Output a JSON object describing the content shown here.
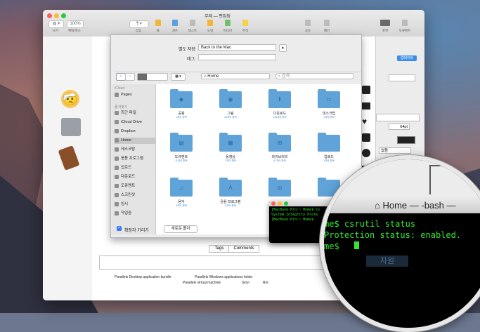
{
  "pages": {
    "title": "무제 — 편집됨",
    "toolbar": {
      "left_btn1": "보기",
      "left_btn2": "확대/축소",
      "zoom_value": "100%",
      "items": [
        {
          "label": "삽입"
        },
        {
          "label": "표"
        },
        {
          "label": "차트"
        },
        {
          "label": "텍스트"
        },
        {
          "label": "도형"
        },
        {
          "label": "미디어"
        },
        {
          "label": "주석"
        },
        {
          "label": "공유"
        },
        {
          "label": "제안"
        },
        {
          "label": "포맷"
        },
        {
          "label": "도큐멘트"
        }
      ]
    },
    "right_panel": {
      "update_btn": "업데이트",
      "size_value": "64pt",
      "style_value": "없음"
    }
  },
  "save_sheet": {
    "save_as_label": "별도 저장:",
    "save_as_value": "Back to the Mac",
    "tags_label": "태그:",
    "tags_value": "",
    "location": "Home",
    "search_placeholder": "검색",
    "sidebar": {
      "icloud_header": "iCloud",
      "icloud_items": [
        {
          "label": "Pages"
        }
      ],
      "favorites_header": "즐겨찾기",
      "favorites": [
        {
          "label": "최근 파일"
        },
        {
          "label": "iCloud Drive"
        },
        {
          "label": "Dropbox"
        },
        {
          "label": "Home"
        },
        {
          "label": "데스크탑"
        },
        {
          "label": "응용 프로그램"
        },
        {
          "label": "업로드"
        },
        {
          "label": "다운로드"
        },
        {
          "label": "도큐멘트"
        },
        {
          "label": "스크린샷"
        },
        {
          "label": "임시"
        },
        {
          "label": "작업중"
        }
      ]
    },
    "folders": [
      {
        "name": "공용",
        "count": "1개의 항목"
      },
      {
        "name": "그림",
        "count": "43개의 항목"
      },
      {
        "name": "다운로드",
        "count": "136개의 항목"
      },
      {
        "name": "데스크탑",
        "count": "1개의 항목"
      },
      {
        "name": "도큐멘트",
        "count": "11개의 항목"
      },
      {
        "name": "동영상",
        "count": "2개의 항목"
      },
      {
        "name": "라이브러리",
        "count": "67개의 항목"
      },
      {
        "name": "업로드",
        "count": "1개의 항목"
      },
      {
        "name": "음악",
        "count": "5개의 항목"
      },
      {
        "name": "응용 프로그램",
        "count": "3개의 항목"
      },
      {
        "name": "",
        "count": ""
      },
      {
        "name": "",
        "count": ""
      }
    ],
    "hide_extension": "확장자 가리기",
    "new_folder": "새로운 폴더"
  },
  "bottom": {
    "tab_tags": "Tags",
    "tab_comments": "Comments",
    "footer_items": [
      "Parallels Desktop application bundle",
      "Parallels Windows applications folder",
      "Parallels virtual machine",
      "Grün",
      "Rot"
    ]
  },
  "terminal": {
    "line1": "[MacBook-Pro:~ Home$ cs",
    "line2": "System Integrity Prote",
    "line3": "[MacBook-Pro:~ Home$ ",
    "button": "자원"
  },
  "magnifier": {
    "title": "Home — -bash —",
    "line1": "me$ csrutil status",
    "line2": " Protection status: enabled.",
    "line3": "me$ "
  }
}
